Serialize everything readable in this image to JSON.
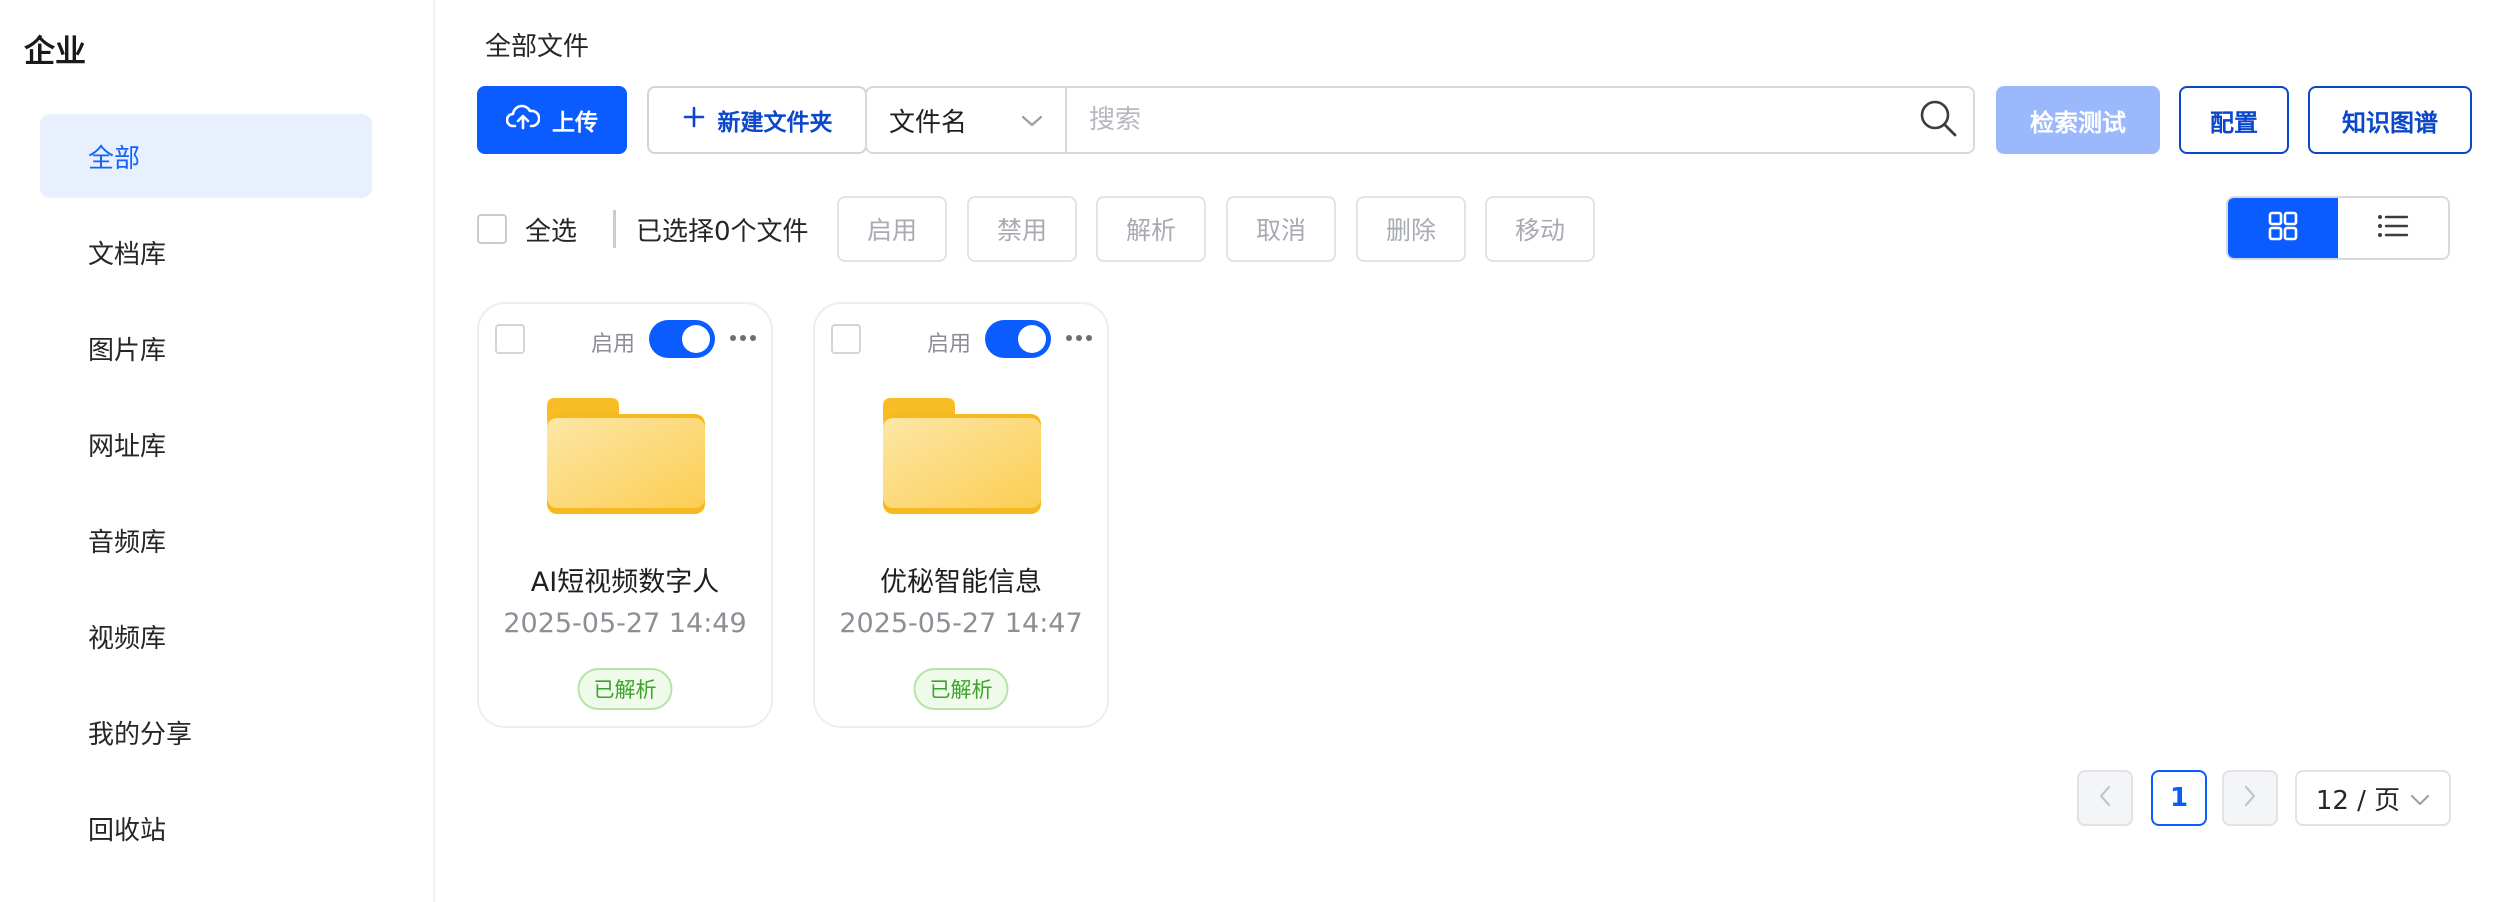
{
  "sidebar": {
    "title": "企业",
    "items": [
      {
        "label": "全部",
        "active": true
      },
      {
        "label": "文档库"
      },
      {
        "label": "图片库"
      },
      {
        "label": "网址库"
      },
      {
        "label": "音频库"
      },
      {
        "label": "视频库"
      },
      {
        "label": "我的分享"
      },
      {
        "label": "回收站"
      }
    ]
  },
  "header": {
    "breadcrumb": "全部文件"
  },
  "toolbar": {
    "upload_label": "上传",
    "new_folder_label": "新建文件夹",
    "search_field_select": "文件名",
    "search_placeholder": "搜索",
    "retrieval_test_label": "检索测试",
    "config_label": "配置",
    "knowledge_graph_label": "知识图谱"
  },
  "selection": {
    "select_all_label": "全选",
    "selected_count_text": "已选择0个文件",
    "actions": [
      "启用",
      "禁用",
      "解析",
      "取消",
      "删除",
      "移动"
    ]
  },
  "view": {
    "mode": "grid"
  },
  "cards": [
    {
      "name": "AI短视频数字人",
      "date": "2025-05-27 14:49",
      "enable_label": "启用",
      "enabled": true,
      "status": "已解析"
    },
    {
      "name": "优秘智能信息",
      "date": "2025-05-27 14:47",
      "enable_label": "启用",
      "enabled": true,
      "status": "已解析"
    }
  ],
  "pagination": {
    "current_page": "1",
    "page_size": "12 / 页"
  },
  "colors": {
    "primary": "#0a5cff",
    "success": "#3aa52a",
    "folder": "#f8c23a"
  }
}
